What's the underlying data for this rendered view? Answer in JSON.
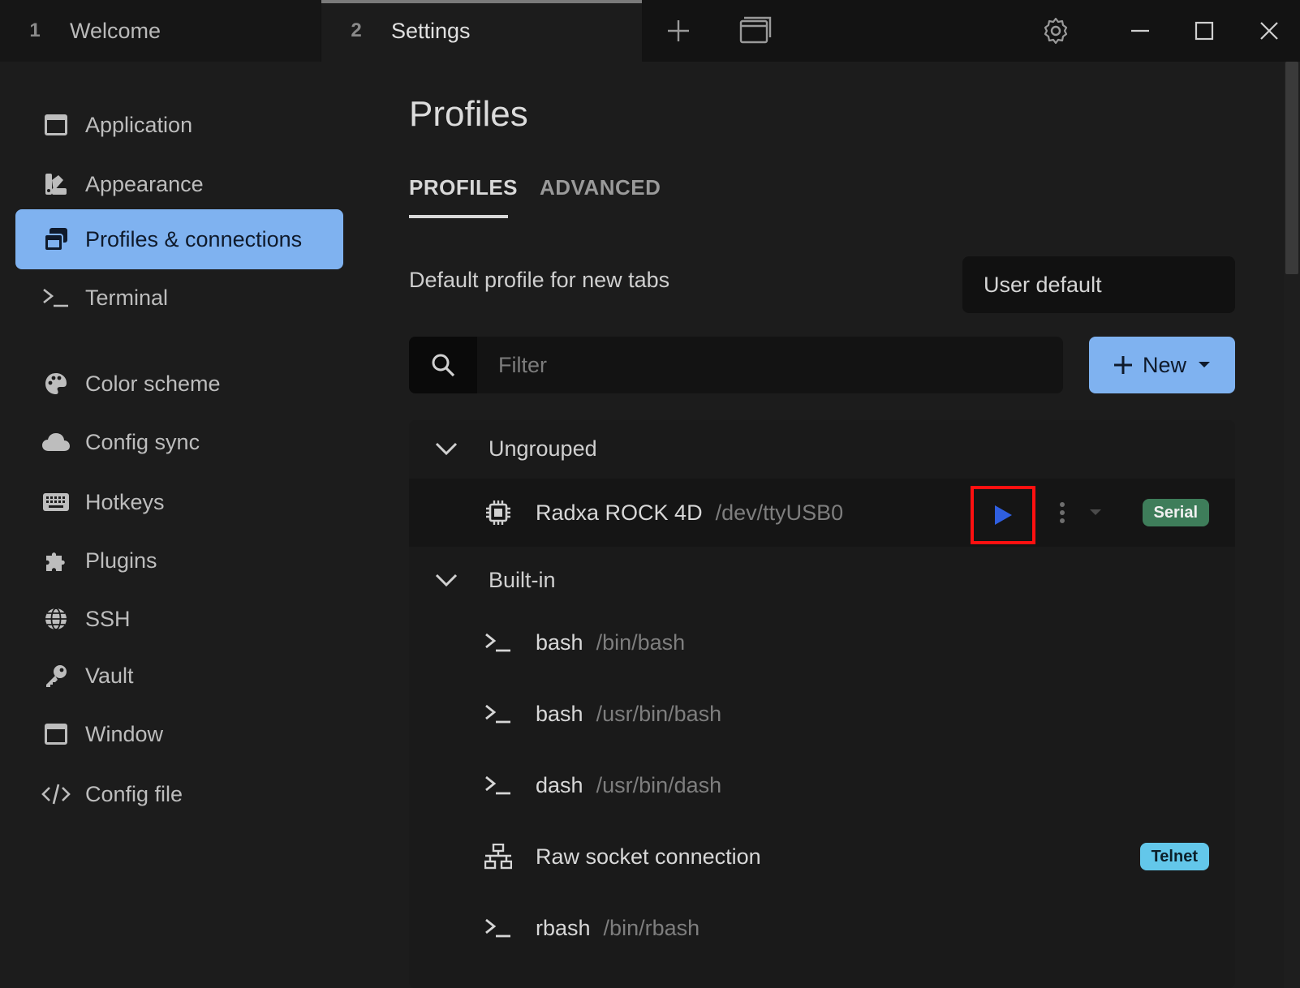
{
  "titlebar": {
    "tabs": [
      {
        "num": "1",
        "title": "Welcome"
      },
      {
        "num": "2",
        "title": "Settings"
      }
    ],
    "buttons": [
      "add-tab-icon",
      "window-icon",
      "gear-icon",
      "minimize-icon",
      "maximize-icon",
      "close-icon"
    ]
  },
  "sidebar": {
    "items": [
      {
        "label": "Application",
        "icon": "window-icon"
      },
      {
        "label": "Appearance",
        "icon": "palette-swatch-icon"
      },
      {
        "label": "Profiles & connections",
        "icon": "windows-stack-icon",
        "active": true
      },
      {
        "label": "Terminal",
        "icon": "terminal-icon"
      },
      {
        "label": "Color scheme",
        "icon": "palette-icon"
      },
      {
        "label": "Config sync",
        "icon": "cloud-icon"
      },
      {
        "label": "Hotkeys",
        "icon": "keyboard-icon"
      },
      {
        "label": "Plugins",
        "icon": "puzzle-icon"
      },
      {
        "label": "SSH",
        "icon": "globe-icon"
      },
      {
        "label": "Vault",
        "icon": "key-icon"
      },
      {
        "label": "Window",
        "icon": "window-icon"
      },
      {
        "label": "Config file",
        "icon": "code-icon"
      }
    ]
  },
  "main": {
    "title": "Profiles",
    "tabs": [
      {
        "label": "PROFILES",
        "active": true
      },
      {
        "label": "ADVANCED"
      }
    ],
    "default_profile_label": "Default profile for new tabs",
    "default_profile_value": "User default",
    "filter_placeholder": "Filter",
    "new_button_label": "New",
    "groups": [
      {
        "name": "Ungrouped",
        "profiles": [
          {
            "name": "Radxa ROCK 4D",
            "path": "/dev/ttyUSB0",
            "icon": "chip-icon",
            "badge": "Serial"
          }
        ]
      },
      {
        "name": "Built-in",
        "profiles": [
          {
            "name": "bash",
            "path": "/bin/bash",
            "icon": "terminal-icon"
          },
          {
            "name": "bash",
            "path": "/usr/bin/bash",
            "icon": "terminal-icon"
          },
          {
            "name": "dash",
            "path": "/usr/bin/dash",
            "icon": "terminal-icon"
          },
          {
            "name": "Raw socket connection",
            "path": "",
            "icon": "network-icon",
            "badge": "Telnet"
          },
          {
            "name": "rbash",
            "path": "/bin/rbash",
            "icon": "terminal-icon"
          }
        ]
      }
    ]
  },
  "colors": {
    "accent": "#7fb2f0",
    "highlight_box": "#ff1010",
    "play": "#2f5fe0",
    "serial_badge": "#3e7d5a",
    "telnet_badge": "#63c7ea"
  }
}
